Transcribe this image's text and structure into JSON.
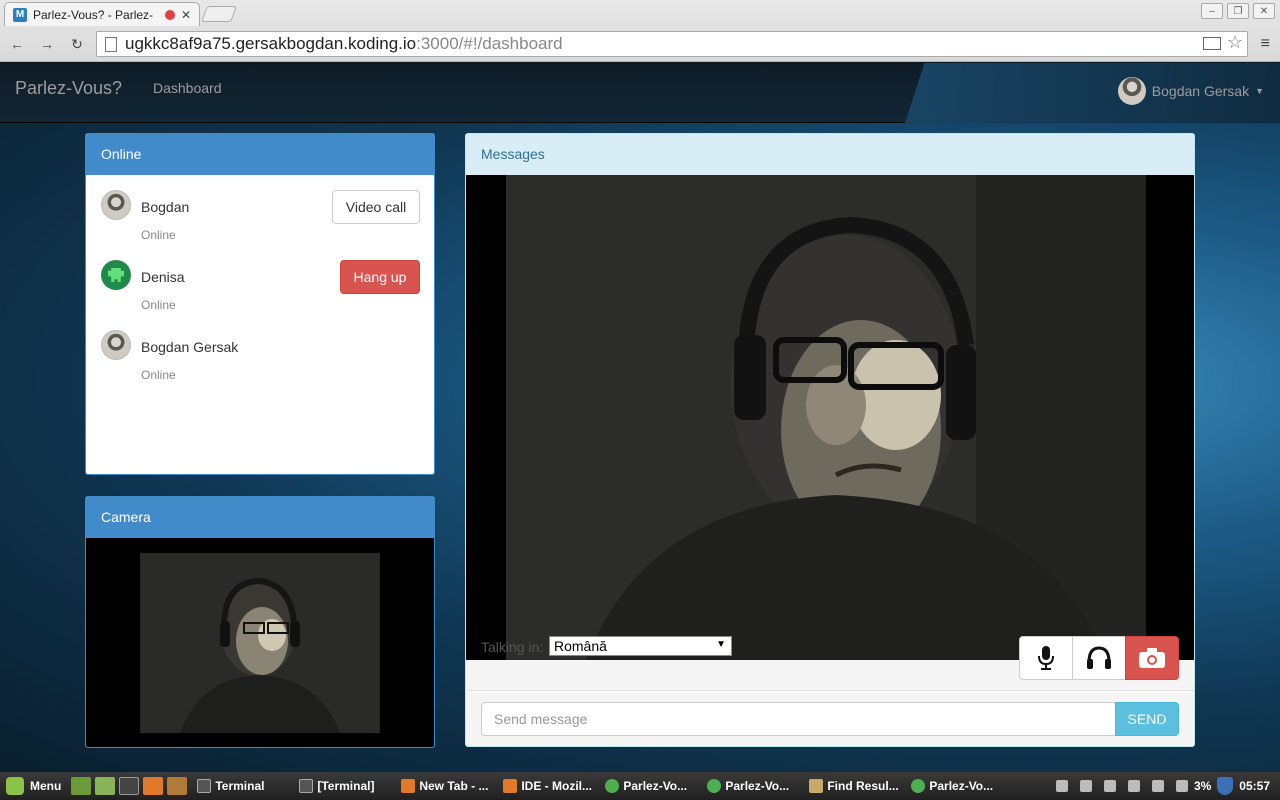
{
  "browser": {
    "tab_title": "Parlez-Vous? - Parlez-",
    "tab_favicon": "M",
    "url_host": "ugkkc8af9a75.gersakbogdan.koding.io",
    "url_rest": ":3000/#!/dashboard"
  },
  "navbar": {
    "brand": "Parlez-Vous?",
    "dashboard_link": "Dashboard",
    "user_name": "Bogdan Gersak"
  },
  "online_panel": {
    "title": "Online",
    "contacts": [
      {
        "name": "Bogdan",
        "status": "Online",
        "action": "Video call",
        "avatar": "photo"
      },
      {
        "name": "Denisa",
        "status": "Online",
        "action": "Hang up",
        "avatar": "alien"
      },
      {
        "name": "Bogdan Gersak",
        "status": "Online",
        "action": "",
        "avatar": "photo"
      }
    ]
  },
  "camera_panel": {
    "title": "Camera"
  },
  "messages_panel": {
    "title": "Messages",
    "talking_label": "Talking in:",
    "language_selected": "Română",
    "controls": [
      "microphone-icon",
      "headphones-icon",
      "camera-icon"
    ],
    "input_placeholder": "Send message",
    "send_label": "SEND"
  },
  "taskbar": {
    "menu_label": "Menu",
    "items": [
      "Terminal",
      "[Terminal]",
      "New Tab - ...",
      "IDE - Mozil...",
      "Parlez-Vo...",
      "Parlez-Vo...",
      "Find Resul...",
      "Parlez-Vo..."
    ],
    "battery": "3%",
    "clock": "05:57"
  },
  "colors": {
    "primary": "#428bca",
    "danger": "#d9534f",
    "info": "#5bc0de",
    "info_heading_bg": "#d9edf7"
  }
}
